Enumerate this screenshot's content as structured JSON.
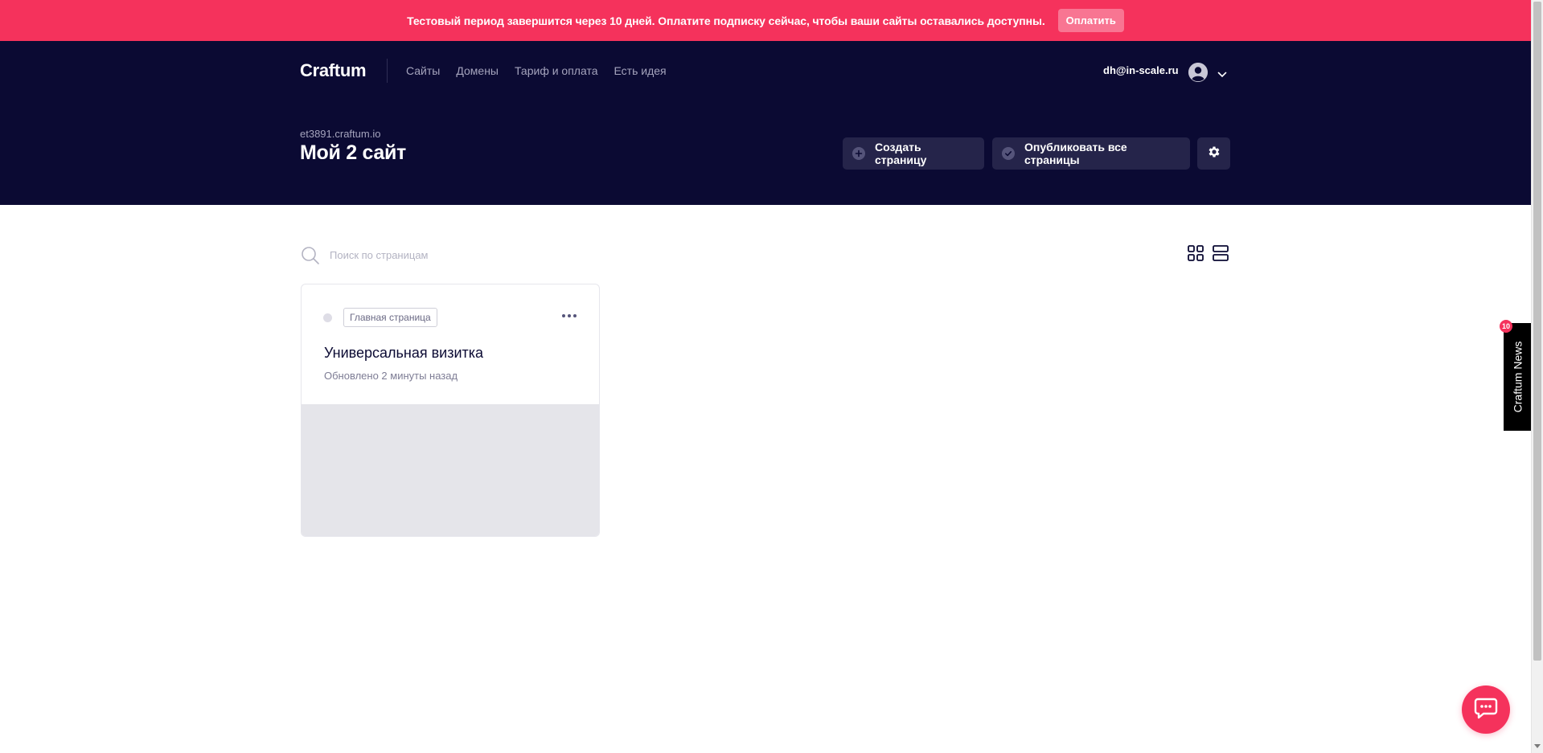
{
  "banner": {
    "text": "Тестовый период завершится через 10 дней. Оплатите подписку сейчас, чтобы ваши сайты оставались доступны.",
    "pay_label": "Оплатить"
  },
  "header": {
    "logo": "Craftum",
    "nav": [
      "Сайты",
      "Домены",
      "Тариф и оплата",
      "Есть идея"
    ],
    "user_email": "dh@in-scale.ru",
    "avatar_icon": "user-avatar-icon",
    "site_domain": "et3891.craftum.io",
    "site_title": "Мой 2 сайт",
    "create_page_label": "Создать страницу",
    "publish_all_label": "Опубликовать все страницы"
  },
  "search": {
    "placeholder": "Поиск по страницам"
  },
  "pages": [
    {
      "badge": "Главная страница",
      "name": "Универсальная визитка",
      "updated": "Обновлено 2 минуты назад"
    }
  ],
  "news": {
    "label": "Craftum News",
    "count": "10"
  },
  "colors": {
    "accent": "#f5325c",
    "header_bg": "#0b0a33",
    "button_bg": "#25244a"
  }
}
